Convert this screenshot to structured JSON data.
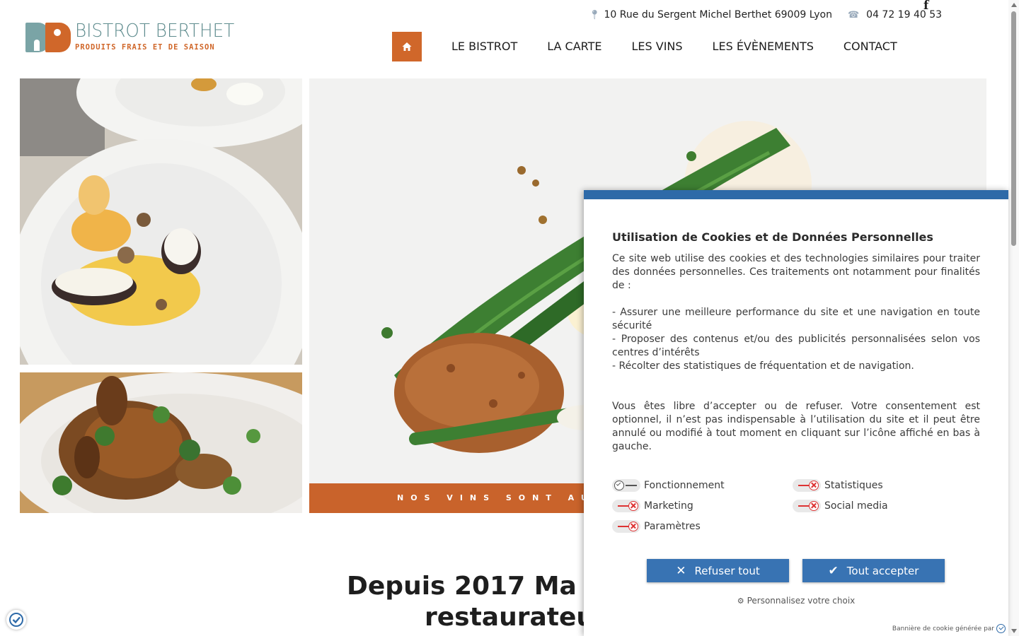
{
  "brand": {
    "name": "BISTROT BERTHET",
    "tagline": "PRODUITS FRAIS ET DE SAISON",
    "colors": {
      "teal": "#7aa4a6",
      "orange": "#d0672a"
    }
  },
  "topbar": {
    "address_icon": "map-pin-icon",
    "address": "10 Rue du Sergent Michel Berthet 69009 Lyon",
    "phone_icon": "phone-icon",
    "phone": "04 72 19 40 53",
    "facebook_icon": "facebook-icon",
    "facebook_glyph": "f"
  },
  "nav": {
    "home_icon": "home-icon",
    "items": [
      "LE BISTROT",
      "LA CARTE",
      "LES VINS",
      "LES ÉVÈNEMENTS",
      "CONTACT"
    ]
  },
  "hero": {
    "banner_text": "NOS VINS SONT AUSS"
  },
  "intro": {
    "title_line1": "Depuis 2017 Ma",
    "title_line2": "restaurateur"
  },
  "cookie_banner": {
    "accent_color": "#2e6aa8",
    "title": "Utilisation de Cookies et de Données Personnelles",
    "intro": "Ce site web utilise des cookies et des technologies similaires pour traiter des données personnelles. Ces traitements ont notamment pour finalités de :",
    "purposes": [
      "- Assurer une meilleure performance du site et une navigation en toute sécurité",
      "- Proposer des contenus et/ou des publicités personnalisées selon vos centres d’intérêts",
      "- Récolter des statistiques de fréquentation et de navigation."
    ],
    "consent_text": "Vous êtes libre d’accepter ou de refuser. Votre consentement est optionnel, il n’est pas indispensable à l’utilisation du site et il peut être annulé ou modifié à tout moment en cliquant sur l’icône affiché en bas à gauche.",
    "toggles": [
      {
        "label": "Fonctionnement",
        "on": true
      },
      {
        "label": "Statistiques",
        "on": false
      },
      {
        "label": "Marketing",
        "on": false
      },
      {
        "label": "Social media",
        "on": false
      },
      {
        "label": "Paramètres",
        "on": false
      }
    ],
    "refuse_label": "Refuser tout",
    "accept_label": "Tout accepter",
    "personalize_label": "Personnalisez votre choix",
    "footer_text": "Bannière de cookie générée par"
  }
}
